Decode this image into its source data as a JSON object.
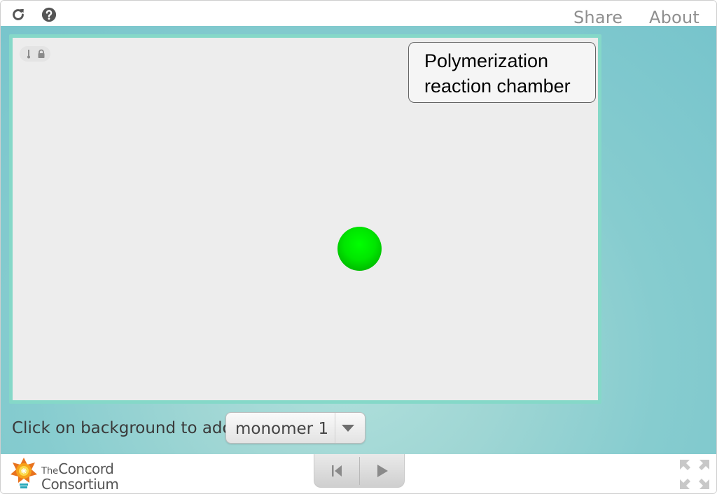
{
  "topbar": {
    "icons": [
      "reload-icon",
      "help-icon"
    ],
    "share_label": "Share",
    "about_label": "About"
  },
  "model": {
    "status_icons": [
      "thermometer-icon",
      "lock-icon"
    ],
    "chamber_label": "Polymerization\nreaction chamber"
  },
  "controls": {
    "instruction": "Click on background to add",
    "monomer_select": {
      "selected": "monomer 1"
    }
  },
  "footer": {
    "logo": {
      "line1_prefix": "The",
      "line1_main": "Concord",
      "line2": "Consortium"
    },
    "playback_icons": [
      "reset-icon",
      "play-icon"
    ],
    "fullscreen_icon": "fullscreen-icon"
  },
  "colors": {
    "teal_background": "#86cccf",
    "model_border": "#85d8c8",
    "model_background": "#ededed",
    "monomer": "#00e600"
  }
}
